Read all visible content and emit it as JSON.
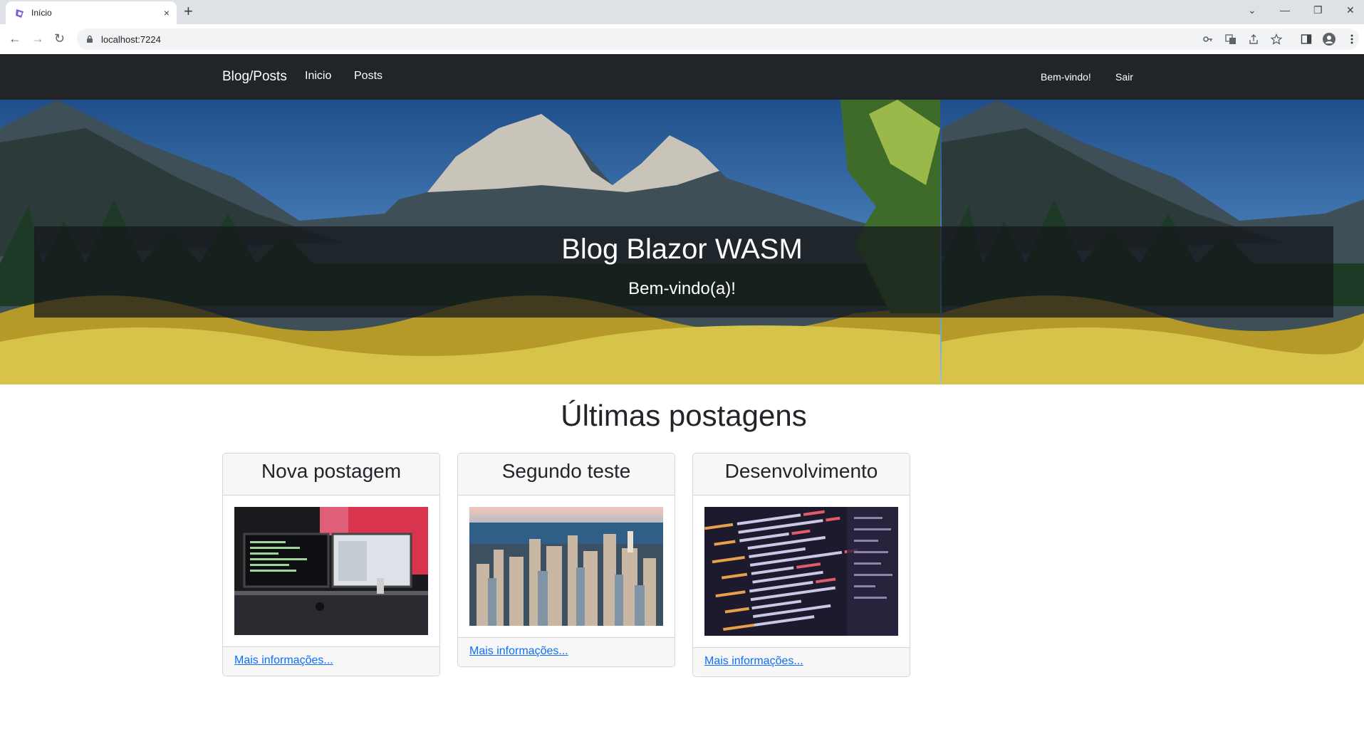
{
  "browser": {
    "tab_title": "Início",
    "tab_close": "×",
    "new_tab": "+",
    "url": "localhost:7224",
    "controls": {
      "dropdown": "⌄",
      "minimize": "—",
      "restore": "❐",
      "close": "✕"
    },
    "nav": {
      "back": "←",
      "forward": "→",
      "reload": "↻"
    }
  },
  "navbar": {
    "brand": "Blog/Posts",
    "links": [
      "Inicio",
      "Posts"
    ],
    "welcome": "Bem-vindo!",
    "logout": "Sair",
    "background": "#212529"
  },
  "hero": {
    "title": "Blog Blazor WASM",
    "subtitle": "Bem-vindo(a)!"
  },
  "posts_section": {
    "title": "Últimas postagens",
    "posts": [
      {
        "title": "Nova postagem",
        "image": "desk-monitors-image",
        "link": "Mais informações..."
      },
      {
        "title": "Segundo teste",
        "image": "city-skyline-image",
        "link": "Mais informações..."
      },
      {
        "title": "Desenvolvimento",
        "image": "code-screen-image",
        "link": "Mais informações..."
      }
    ]
  },
  "colors": {
    "link": "#0d6efd",
    "card_header_bg": "#f7f7f7"
  }
}
